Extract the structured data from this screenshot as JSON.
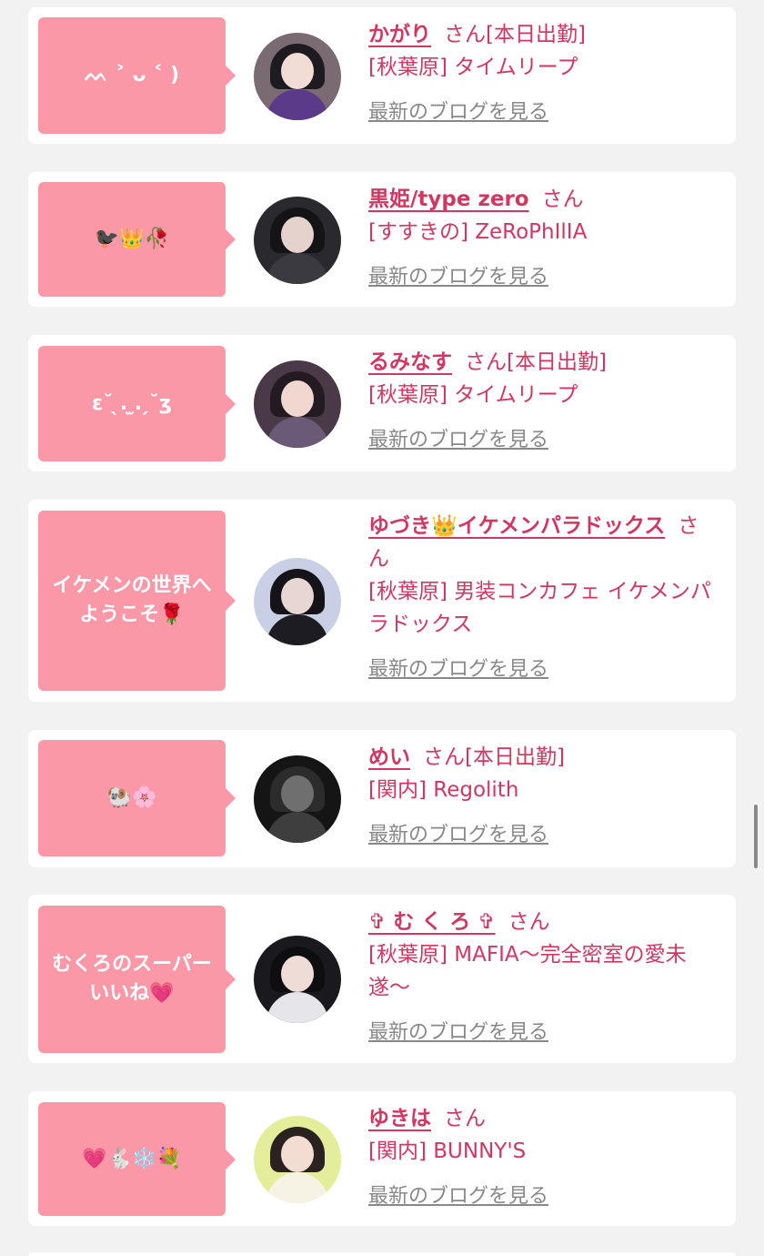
{
  "theme": {
    "accent": "#d53660",
    "bubble": "#fb98a7",
    "link_gray": "#888888",
    "background": "#f2f2f2"
  },
  "items": [
    {
      "message": "ᨓ ˃ ᴗ ˂ )",
      "name": "かがり",
      "suffix": "さん[本日出勤]",
      "shop": "[秋葉原] タイムリープ",
      "blog": "最新のブログを見る",
      "avatar_colors": [
        "#7a6a72",
        "#f2dcd6",
        "#1d1a20",
        "#5b3a8a"
      ]
    },
    {
      "message": "🐦‍⬛👑🥀",
      "name": "黒姫/type zero",
      "suffix": "さん",
      "shop": "[すすきの] ZeRoPhIlIA",
      "blog": "最新のブログを見る",
      "avatar_colors": [
        "#2a2a2e",
        "#e6d2cc",
        "#141416",
        "#3a3a40"
      ]
    },
    {
      "message": "ε˘ ̖. ̫. ̗˘ʒ",
      "name": "るみなす",
      "suffix": "さん[本日出勤]",
      "shop": "[秋葉原] タイムリープ",
      "blog": "最新のブログを見る",
      "avatar_colors": [
        "#4a3a48",
        "#f0d8d0",
        "#241a22",
        "#6a5a78"
      ]
    },
    {
      "message": "イケメンの世界へ\nようこそ🌹",
      "name": "ゆづき👑イケメンパラドックス",
      "suffix": "さん",
      "shop": "[秋葉原] 男装コンカフェ イケメンパラドックス",
      "blog": "最新のブログを見る",
      "avatar_colors": [
        "#c9d0e6",
        "#e8d6d2",
        "#141418",
        "#1c1c22"
      ]
    },
    {
      "message": "🐏🌸",
      "name": "めい",
      "suffix": "さん[本日出勤]",
      "shop": "[関内] Regolith",
      "blog": "最新のブログを見る",
      "avatar_colors": [
        "#151515",
        "#6f6f6f",
        "#2c2c2c",
        "#3e3e3e"
      ]
    },
    {
      "message": "むくろのスーパー\nいいね💗",
      "name": "✞ む く ろ ✞",
      "suffix": "さん",
      "shop": "[秋葉原] MAFIA〜完全密室の愛未遂〜",
      "blog": "最新のブログを見る",
      "avatar_colors": [
        "#1a1a1e",
        "#f0dcd6",
        "#0e0e10",
        "#e6e6ea"
      ]
    },
    {
      "message": "💗🐇❄️💐",
      "name": "ゆきは",
      "suffix": "さん",
      "shop": "[関内] BUNNY'S",
      "blog": "最新のブログを見る",
      "avatar_colors": [
        "#e4ee9a",
        "#f3ddd2",
        "#2a2220",
        "#f6f3e4"
      ]
    }
  ]
}
